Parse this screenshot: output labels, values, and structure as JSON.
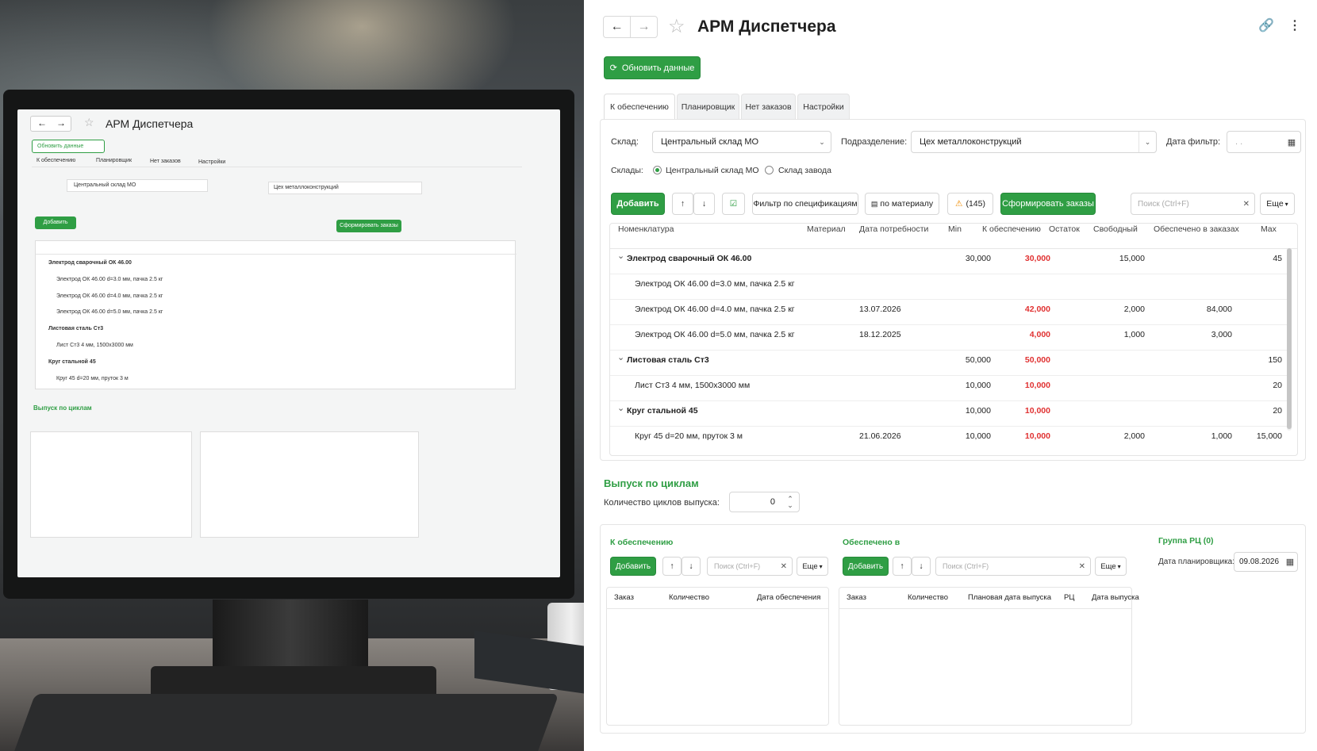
{
  "window": {
    "title": "АРМ Диспетчера",
    "refresh_label": "Обновить данные"
  },
  "tabs": [
    "К обеспечению",
    "Планировщик",
    "Нет заказов",
    "Настройки"
  ],
  "filters": {
    "warehouse_label": "Склад:",
    "warehouse_value": "Центральный склад МО",
    "division_label": "Подразделение:",
    "division_value": "Цех металлоконструкций",
    "date_label": "Дата фильтр:",
    "date_value": ". .",
    "warehouses_label": "Склады:",
    "radio_central": "Центральный склад МО",
    "radio_plant": "Склад завода"
  },
  "toolbar": {
    "add": "Добавить",
    "up": "↑",
    "down": "↓",
    "filter_spec": "Фильтр по спецификациям",
    "by_material": "по материалу",
    "warn_count": "(145)",
    "form_orders": "Сформировать заказы",
    "search_placeholder": "Поиск (Ctrl+F)",
    "more": "Еще"
  },
  "table": {
    "headers": [
      "Номенклатура",
      "Материал",
      "Дата потребности",
      "Min",
      "К обеспечению",
      "Остаток",
      "Свободный",
      "Обеспечено в заказах",
      "Max"
    ],
    "rows": [
      {
        "group": true,
        "name": "Электрод сварочный ОК 46.00",
        "date": "",
        "min": "30,000",
        "need": "30,000",
        "rest": "",
        "free": "15,000",
        "ordered": "",
        "max": "45"
      },
      {
        "group": false,
        "name": "Электрод ОК 46.00 d=3.0 мм, пачка 2.5 кг",
        "date": "",
        "min": "",
        "need": "",
        "rest": "",
        "free": "",
        "ordered": "",
        "max": ""
      },
      {
        "group": false,
        "name": "Электрод ОК 46.00 d=4.0 мм, пачка 2.5 кг",
        "date": "13.07.2026",
        "min": "",
        "need": "42,000",
        "rest": "",
        "free": "2,000",
        "ordered": "84,000",
        "max": ""
      },
      {
        "group": false,
        "name": "Электрод ОК 46.00 d=5.0 мм, пачка 2.5 кг",
        "date": "18.12.2025",
        "min": "",
        "need": "4,000",
        "rest": "",
        "free": "1,000",
        "ordered": "3,000",
        "max": ""
      },
      {
        "group": true,
        "name": "Листовая сталь Ст3",
        "date": "",
        "min": "50,000",
        "need": "50,000",
        "rest": "",
        "free": "",
        "ordered": "",
        "max": "150"
      },
      {
        "group": false,
        "name": "Лист Ст3 4 мм, 1500x3000 мм",
        "date": "",
        "min": "10,000",
        "need": "10,000",
        "rest": "",
        "free": "",
        "ordered": "",
        "max": "20"
      },
      {
        "group": true,
        "name": "Круг стальной 45",
        "date": "",
        "min": "10,000",
        "need": "10,000",
        "rest": "",
        "free": "",
        "ordered": "",
        "max": "20"
      },
      {
        "group": false,
        "name": "Круг 45 d=20 мм, пруток 3 м",
        "date": "21.06.2026",
        "min": "10,000",
        "need": "10,000",
        "rest": "",
        "free": "2,000",
        "ordered": "1,000",
        "max": "15,000"
      }
    ]
  },
  "cycles": {
    "title": "Выпуск по циклам",
    "count_label": "Количество циклов выпуска:",
    "count_value": "0"
  },
  "bottom": {
    "left": {
      "title": "К обеспечению",
      "add": "Добавить",
      "search": "Поиск (Ctrl+F)",
      "more": "Еще",
      "headers": [
        "Заказ",
        "Количество",
        "Дата обеспечения"
      ]
    },
    "mid": {
      "title": "Обеспечено в",
      "add": "Добавить",
      "search": "Поиск (Ctrl+F)",
      "more": "Еще",
      "headers": [
        "Заказ",
        "Количество",
        "Плановая дата выпуска",
        "РЦ",
        "Дата выпуска"
      ]
    },
    "right": {
      "title": "Группа РЦ (0)",
      "date_label": "Дата планировщика:",
      "date_value": "09.08.2026"
    }
  },
  "colors": {
    "accent": "#2f9e44",
    "negative": "#e03131"
  },
  "icons": [
    "arrow-left-icon",
    "arrow-right-icon",
    "star-icon",
    "link-icon",
    "more-vertical-icon",
    "refresh-icon",
    "calendar-icon",
    "checkbox-icon",
    "document-icon",
    "warning-icon",
    "chevron-down-icon",
    "close-icon"
  ]
}
